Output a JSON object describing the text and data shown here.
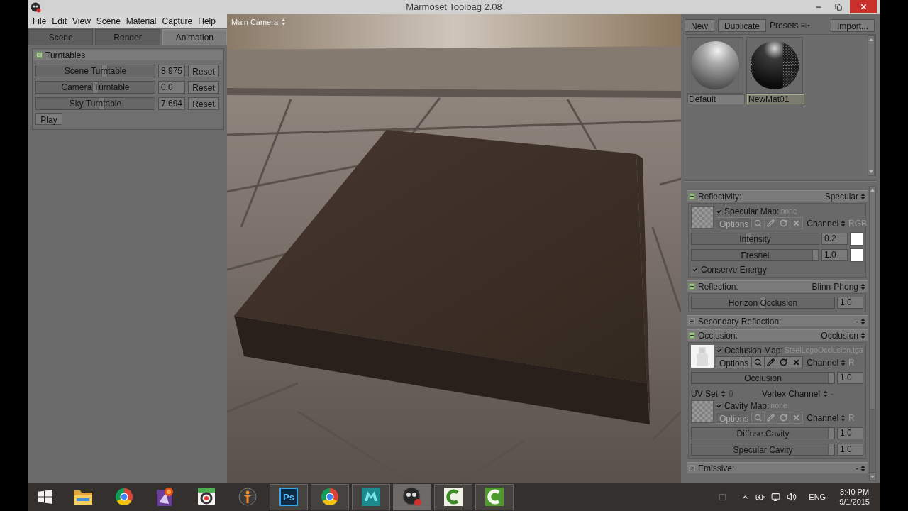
{
  "window": {
    "title": "Marmoset Toolbag 2.08"
  },
  "menu": [
    "File",
    "Edit",
    "View",
    "Scene",
    "Material",
    "Capture",
    "Help"
  ],
  "tabs": [
    {
      "label": "Scene",
      "selected": false
    },
    {
      "label": "Render",
      "selected": false
    },
    {
      "label": "Animation",
      "selected": true
    }
  ],
  "turntables": {
    "title": "Turntables",
    "expanded": true,
    "rows": [
      {
        "label": "Scene Turntable",
        "level": 0.58,
        "value": "8.975",
        "button": "Reset"
      },
      {
        "label": "Camera Turntable",
        "level": 0.5,
        "value": "0.0",
        "button": "Reset"
      },
      {
        "label": "Sky Turntable",
        "level": 0.56,
        "value": "7.694",
        "button": "Reset"
      }
    ],
    "play": "Play"
  },
  "viewport": {
    "camera": "Main Camera"
  },
  "materials": {
    "buttons": [
      "New",
      "Duplicate"
    ],
    "presets": "Presets",
    "import": "Import...",
    "items": [
      {
        "name": "Default",
        "kind": "plain",
        "selected": false
      },
      {
        "name": "NewMat01",
        "kind": "textured",
        "selected": true
      }
    ]
  },
  "sections": [
    {
      "title": "Reflectivity:",
      "expanded": true,
      "mode": "Specular",
      "rows": [
        {
          "kind": "map",
          "checked": true,
          "label": "Specular Map:",
          "file": "none",
          "enabled": false,
          "options": "Options",
          "channel_label": "Channel",
          "channel": "RGB"
        },
        {
          "kind": "slider",
          "label": "Intensity",
          "level": 0.44,
          "value": "0.2",
          "color": "#ffffff"
        },
        {
          "kind": "slider",
          "label": "Fresnel",
          "level": 1,
          "value": "1.0",
          "color": "#ffffff"
        },
        {
          "kind": "checkbox",
          "label": "Conserve Energy",
          "checked": true
        }
      ]
    },
    {
      "title": "Reflection:",
      "expanded": true,
      "mode": "Blinn-Phong",
      "rows": [
        {
          "kind": "slider",
          "label": "Horizon Occlusion",
          "level": 0.5,
          "value": "1.0"
        }
      ]
    },
    {
      "title": "Secondary Reflection:",
      "expanded": false,
      "mode": "-"
    },
    {
      "title": "Occlusion:",
      "expanded": true,
      "mode": "Occlusion",
      "rows": [
        {
          "kind": "map",
          "checked": true,
          "label": "Occlusion Map:",
          "file": "SteelLogoOcclusion.tga",
          "enabled": true,
          "options": "Options",
          "channel_label": "Channel",
          "channel": "R"
        },
        {
          "kind": "slider",
          "label": "Occlusion",
          "level": 1,
          "value": "1.0"
        },
        {
          "kind": "selectors",
          "items": [
            {
              "label": "UV Set",
              "value": "0"
            },
            {
              "label": "Vertex Channel",
              "value": "-"
            }
          ]
        },
        {
          "kind": "map",
          "checked": true,
          "label": "Cavity Map:",
          "file": "none",
          "enabled": false,
          "options": "Options",
          "channel_label": "Channel",
          "channel": "R"
        },
        {
          "kind": "slider",
          "label": "Diffuse Cavity",
          "level": 1,
          "value": "1.0"
        },
        {
          "kind": "slider",
          "label": "Specular Cavity",
          "level": 1,
          "value": "1.0"
        }
      ]
    },
    {
      "title": "Emissive:",
      "expanded": false,
      "mode": "-"
    }
  ],
  "taskbar": {
    "apps": [
      {
        "kind": "folder",
        "running": false,
        "selected": false
      },
      {
        "kind": "wheel",
        "running": false,
        "selected": false
      },
      {
        "kind": "badge",
        "running": false,
        "selected": false
      },
      {
        "kind": "camera",
        "running": false,
        "selected": false
      },
      {
        "kind": "figure",
        "running": false,
        "selected": false
      },
      {
        "kind": "letters",
        "glyph": "Ps",
        "running": true,
        "selected": false
      },
      {
        "kind": "wheel",
        "running": true,
        "selected": false
      },
      {
        "kind": "cube",
        "running": true,
        "selected": false
      },
      {
        "kind": "sphere",
        "running": true,
        "selected": true
      },
      {
        "kind": "arc",
        "running": true,
        "selected": false
      },
      {
        "kind": "arcgreen",
        "running": true,
        "selected": false
      }
    ],
    "tray": {
      "language": "ENG",
      "time": "8:40 PM",
      "date": "9/1/2015"
    }
  }
}
